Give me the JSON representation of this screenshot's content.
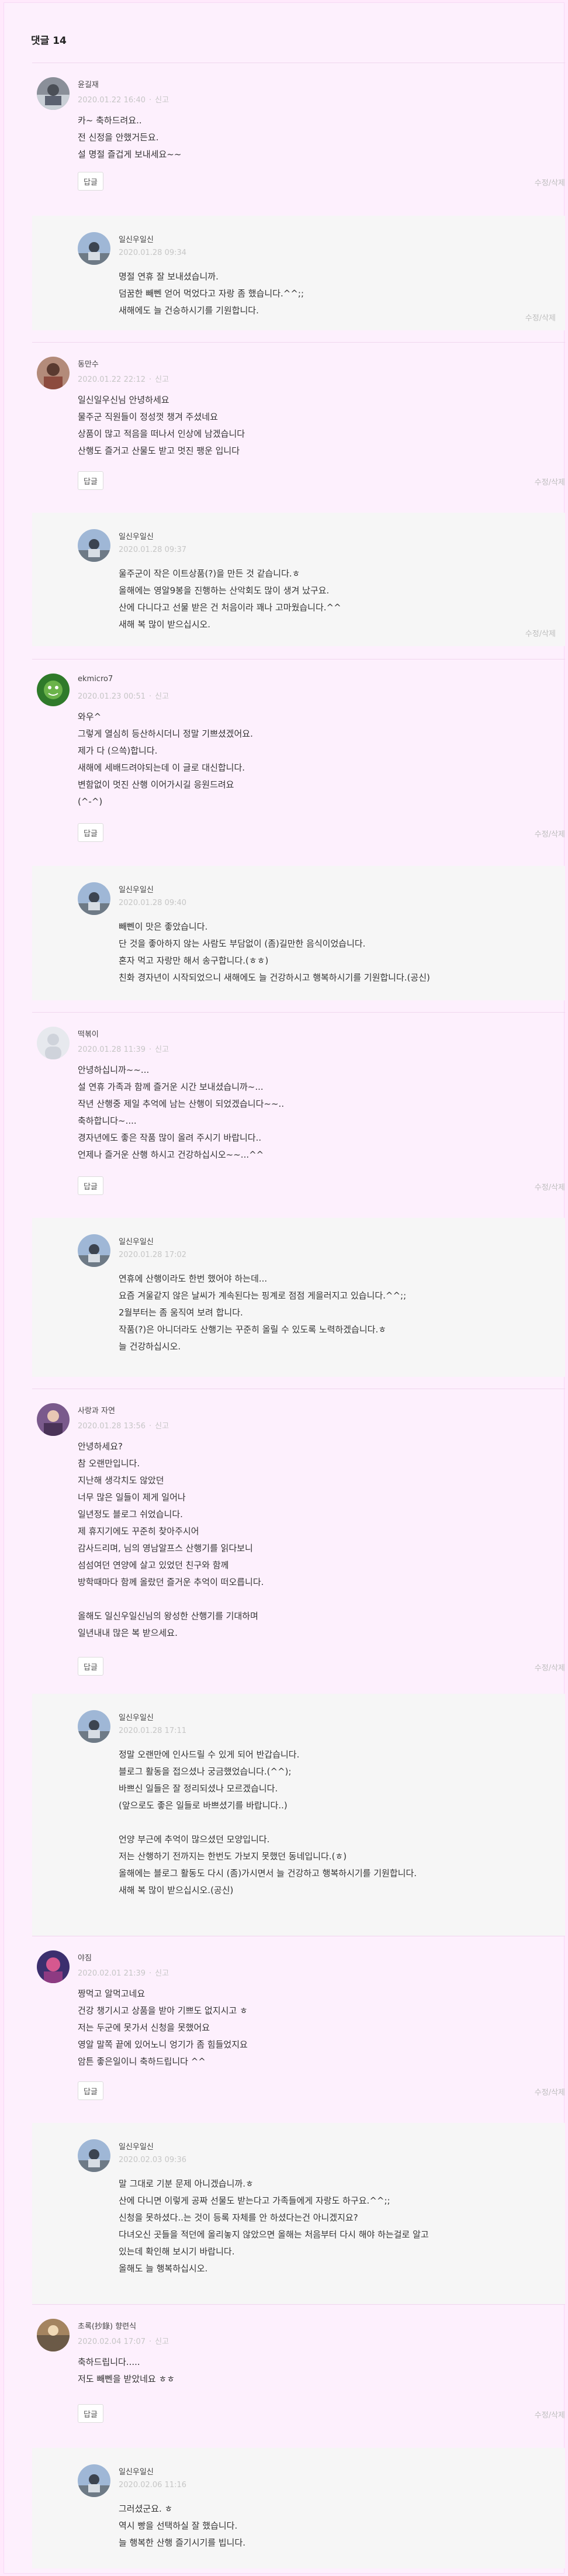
{
  "header": {
    "title": "댓글 14"
  },
  "reply_label": "답글",
  "edit_label": "수정",
  "delete_label": "삭제",
  "secret_label": "신고",
  "comments": [
    {
      "author": "윤길재",
      "date": "2020.01.22 16:40",
      "lines": [
        "카~ 축하드려요..",
        "전 신정을 안했거든요.",
        "설 명절 즐겁게 보내세요~~"
      ],
      "reply": {
        "author": "일신우일신",
        "date": "2020.01.28 09:34",
        "lines": [
          "명절 연휴 잘 보내셨습니까.",
          "덤꿈한 빼뻰 얻어 먹었다고 자랑 좀 했습니다.^^;;",
          "새해에도 늘 건승하시기를 기원합니다."
        ]
      }
    },
    {
      "author": "동만수",
      "date": "2020.01.22 22:12",
      "lines": [
        "일신일우신님 안녕하세요",
        "물주군 직원들이 정성껏 챙겨 주셨네요",
        "상품이 많고 적음을 떠나서 인상에 남겠습니다",
        "산행도 즐거고 산물도 받고 멋진 팽운 입니다"
      ],
      "reply": {
        "author": "일신우일신",
        "date": "2020.01.28 09:37",
        "lines": [
          "울주군이 작은 이트상품(?)을 만든 것 같습니다.ㅎ",
          "올해에는 영알9봉을 진행하는 산악회도 많이 생겨 났구요.",
          "산에 다니다고 선물 받은 건 처음이라 꽤나 고마웠습니다.^^",
          "새해 복 많이 받으십시오."
        ]
      }
    },
    {
      "author": "ekmicro7",
      "date": "2020.01.23 00:51",
      "lines": [
        "와우^",
        "그렇게 열심히 등산하시더니 정말 기쁘셨겠어요.",
        "제가 다 (으쓱)합니다.",
        "새해에 세배드려야되는데 이 글로 대신합니다.",
        "변함없이 멋진 산행 이어가시길 응원드려요",
        "(^-^)"
      ],
      "reply": {
        "author": "일신우일신",
        "date": "2020.01.28 09:40",
        "lines": [
          "빼뻰이 맛은 좋았습니다.",
          "단 것을 좋아하지 않는 사람도 부담없이 (좀)길만한 음식이었습니다.",
          "혼자 먹고 자랑만 해서 송구합니다.(ㅎㅎ)",
          "친화 경자년이 시작되었으니 새해에도 늘 건강하시고 행복하시기를 기원합니다.(공신)"
        ]
      }
    },
    {
      "author": "떡볶이",
      "date": "2020.01.28 11:39",
      "lines": [
        "안녕하십니까~~...",
        "설 연휴 가족과 함께 즐거운 시간 보내셨습니까~...",
        "작년 산행중 제일 추억에 남는 산행이 되었겠습니다~~..",
        "축하합니다~....",
        "경자년에도 좋은 작품 많이 올려 주시기 바랍니다..",
        "언제나 즐거운 산행 하시고 건강하십시오~~...^^"
      ],
      "reply": {
        "author": "일신우일신",
        "date": "2020.01.28 17:02",
        "lines": [
          "연휴에 산행이라도 한번 했어야 하는데...",
          "요즘 겨울같지 않은 날씨가 계속된다는 핑계로 점점 게을러지고 있습니다.^^;;",
          "2월부터는 좀 움직여 보려 합니다.",
          "작품(?)은 아니더라도 산행기는 꾸준히 올릴 수 있도록 노력하겠습니다.ㅎ",
          "늘 건강하십시오."
        ]
      }
    },
    {
      "author": "사랑과 자연",
      "date": "2020.01.28 13:56",
      "lines": [
        "안녕하세요?",
        "참 오랜만입니다.",
        "지난해 생각치도 않았던",
        "너무 많은 일들이 제게 일어나",
        "일년정도 블로그 쉬었습니다.",
        "제 휴지기에도 꾸준히 찾아주시어",
        "감사드리며, 님의 영남알프스 산행기를 읽다보니",
        "섬섬여던 연양에 살고 있었던 친구와 함께",
        "방학때마다 함께 올랐던 즐거운 추억이 떠오릅니다.",
        "",
        "올해도 일신우일신님의 왕성한 산행기를 기대하며",
        "일년내내 많은 복 받으세요."
      ],
      "reply": {
        "author": "일신우일신",
        "date": "2020.01.28 17:11",
        "lines": [
          "정말 오랜만에 인사드릴 수 있게 되어 반갑습니다.",
          "블로그 활동을 접으셨나 궁금했었습니다.(^^);",
          "바쁘신 일들은 잘 정리되셨나 모르겠습니다.",
          "(앞으로도 좋은 일들로 바쁘셨기를 바랍니다..)",
          "",
          "언양 부근에 추억이 많으셨던 모양입니다.",
          "저는 산행하기 전까지는 한번도 가보지 못했던 동네입니다.(ㅎ)",
          "올해에는 블로그 활동도 다시 (좀)가시면서 늘 건강하고 행복하시기를 기원합니다.",
          "새해 복 많이 받으십시오.(공신)"
        ]
      }
    },
    {
      "author": "야짐",
      "date": "2020.02.01 21:39",
      "lines": [
        "짱먹고 알먹고네요",
        "건강 챙기시고 상품을 받아 기쁘도 없지시고 ㅎ",
        "저는 두군에 못가서 신청을 못했어요",
        "영알 말쪽 끝에 있어노니 엉기가 좀 힘들었지요",
        "암튼 좋은일이니 축하드립니다 ^^"
      ],
      "reply": {
        "author": "일신우일신",
        "date": "2020.02.03 09:36",
        "lines": [
          "말 그대로 기분 문제 아니겠습니까.ㅎ",
          "산에 다니면 이렇게 공짜 선물도 받는다고 가족들에게 자랑도 하구요.^^;;",
          "신청을 못하셨다..는 것이 등록 자체를 안 하셨다는건 아니겠지요?",
          "다녀오신 곳들을 적던에 올리놓지 않았으면 올해는 처음부터 다시 해야 하는걸로 알고",
          "있는데 확인해 보시기 바랍니다.",
          "올해도 늘 행복하십시오."
        ]
      }
    },
    {
      "author": "초록(抄錄) 향련식",
      "date": "2020.02.04 17:07",
      "lines": [
        "축하드립니다.....",
        "저도 빼뻰을 받았네요 ㅎㅎ"
      ],
      "reply": {
        "author": "일신우일신",
        "date": "2020.02.06 11:16",
        "lines": [
          "그러셨군요. ㅎ",
          "역시 빵을 선택하실 잘 했습니다.",
          "늘 행복한 산행 즐기시기를 빕니다."
        ]
      }
    }
  ]
}
